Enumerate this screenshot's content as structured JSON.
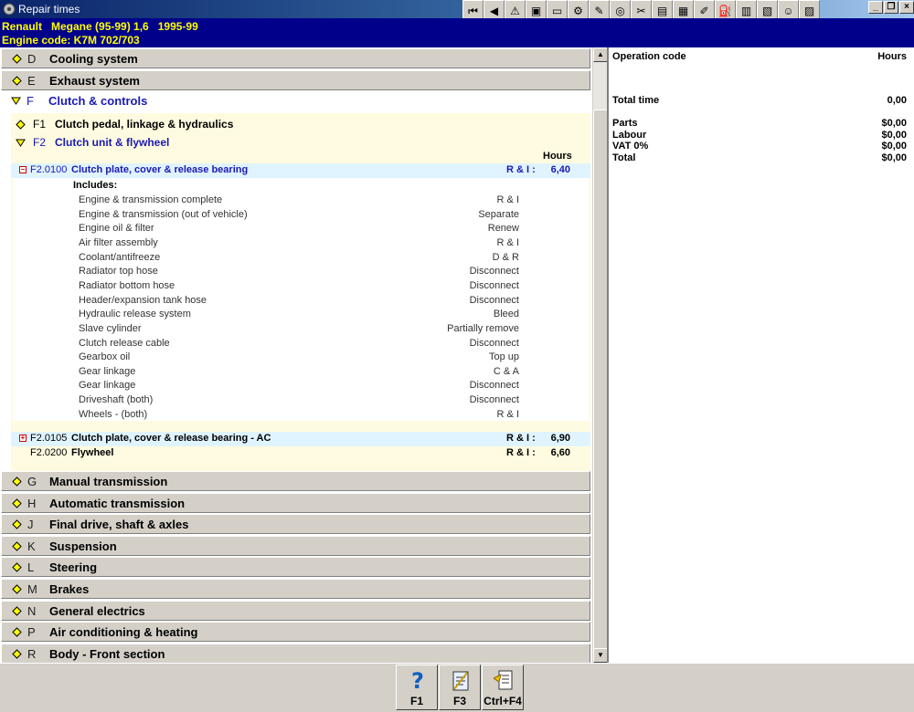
{
  "window": {
    "title": "Repair times"
  },
  "toolbar": {
    "buttons": [
      {
        "name": "first-icon",
        "glyph": "⏮"
      },
      {
        "name": "back-icon",
        "glyph": "◀"
      },
      {
        "name": "warning-icon",
        "glyph": "⚠"
      },
      {
        "name": "engine-icon",
        "glyph": "▣"
      },
      {
        "name": "monitor-icon",
        "glyph": "▭"
      },
      {
        "name": "settings-icon",
        "glyph": "⚙"
      },
      {
        "name": "wrench-icon",
        "glyph": "✎"
      },
      {
        "name": "gauge-icon",
        "glyph": "◎"
      },
      {
        "name": "tools-icon",
        "glyph": "✂"
      },
      {
        "name": "chart-icon",
        "glyph": "▤"
      },
      {
        "name": "save-icon",
        "glyph": "▦"
      },
      {
        "name": "brush-icon",
        "glyph": "✐"
      },
      {
        "name": "fuel-icon",
        "glyph": "⛽"
      },
      {
        "name": "print-icon",
        "glyph": "▥"
      },
      {
        "name": "car-icon",
        "glyph": "▧"
      },
      {
        "name": "smiley-icon",
        "glyph": "☺"
      },
      {
        "name": "calendar-icon",
        "glyph": "▨"
      }
    ]
  },
  "vehicle": {
    "line1": "Renault   Megane (95-99) 1,6   1995-99",
    "line2": "Engine code: K7M 702/703"
  },
  "categories_top": [
    {
      "letter": "D",
      "label": "Cooling system"
    },
    {
      "letter": "E",
      "label": "Exhaust system"
    }
  ],
  "open_category": {
    "letter": "F",
    "label": "Clutch & controls"
  },
  "subcategories": [
    {
      "code": "F1",
      "label": "Clutch pedal, linkage & hydraulics"
    },
    {
      "code": "F2",
      "label": "Clutch unit & flywheel"
    }
  ],
  "ops_header": "Hours",
  "operations": [
    {
      "code": "F2.0100",
      "desc": "Clutch plate, cover & release bearing",
      "ri": "R & I :",
      "hours": "6,40",
      "expand": "−"
    },
    {
      "code": "F2.0105",
      "desc": "Clutch plate, cover & release bearing - AC",
      "ri": "R & I :",
      "hours": "6,90",
      "expand": "+"
    },
    {
      "code": "F2.0200",
      "desc": "Flywheel",
      "ri": "R & I :",
      "hours": "6,60",
      "expand": ""
    }
  ],
  "includes": {
    "title": "Includes:",
    "items": [
      {
        "name": "Engine & transmission complete",
        "action": "R & I"
      },
      {
        "name": "Engine & transmission (out of vehicle)",
        "action": "Separate"
      },
      {
        "name": "Engine oil & filter",
        "action": "Renew"
      },
      {
        "name": "Air filter assembly",
        "action": "R & I"
      },
      {
        "name": "Coolant/antifreeze",
        "action": "D & R"
      },
      {
        "name": "Radiator top hose",
        "action": "Disconnect"
      },
      {
        "name": "Radiator bottom hose",
        "action": "Disconnect"
      },
      {
        "name": "Header/expansion tank hose",
        "action": "Disconnect"
      },
      {
        "name": "Hydraulic release system",
        "action": "Bleed"
      },
      {
        "name": "Slave cylinder",
        "action": "Partially remove"
      },
      {
        "name": "Clutch release cable",
        "action": "Disconnect"
      },
      {
        "name": "Gearbox oil",
        "action": "Top up"
      },
      {
        "name": "Gear linkage",
        "action": "C & A"
      },
      {
        "name": "Gear linkage",
        "action": "Disconnect"
      },
      {
        "name": "Driveshaft (both)",
        "action": "Disconnect"
      },
      {
        "name": "Wheels - (both)",
        "action": "R & I"
      }
    ]
  },
  "categories_bottom": [
    {
      "letter": "G",
      "label": "Manual transmission"
    },
    {
      "letter": "H",
      "label": "Automatic transmission"
    },
    {
      "letter": "J",
      "label": "Final drive, shaft & axles"
    },
    {
      "letter": "K",
      "label": "Suspension"
    },
    {
      "letter": "L",
      "label": "Steering"
    },
    {
      "letter": "M",
      "label": "Brakes"
    },
    {
      "letter": "N",
      "label": "General electrics"
    },
    {
      "letter": "P",
      "label": "Air conditioning & heating"
    },
    {
      "letter": "R",
      "label": "Body - Front section"
    }
  ],
  "summary": {
    "header_left": "Operation code",
    "header_right": "Hours",
    "total_time_label": "Total time",
    "total_time_value": "0,00",
    "rows": [
      {
        "label": "Parts",
        "value": "$0,00"
      },
      {
        "label": "Labour",
        "value": "$0,00"
      },
      {
        "label": "VAT 0%",
        "value": "$0,00"
      },
      {
        "label": "Total",
        "value": "$0,00"
      }
    ]
  },
  "bottom_buttons": [
    {
      "label": "F1",
      "icon": "help-icon"
    },
    {
      "label": "F3",
      "icon": "notepad-icon"
    },
    {
      "label": "Ctrl+F4",
      "icon": "edit-notes-icon"
    }
  ],
  "colors": {
    "vehicle_bg": "#00008b",
    "vehicle_text": "#ffff00",
    "selected_text": "#1a1ab4",
    "open_bg": "#fffbe0"
  }
}
